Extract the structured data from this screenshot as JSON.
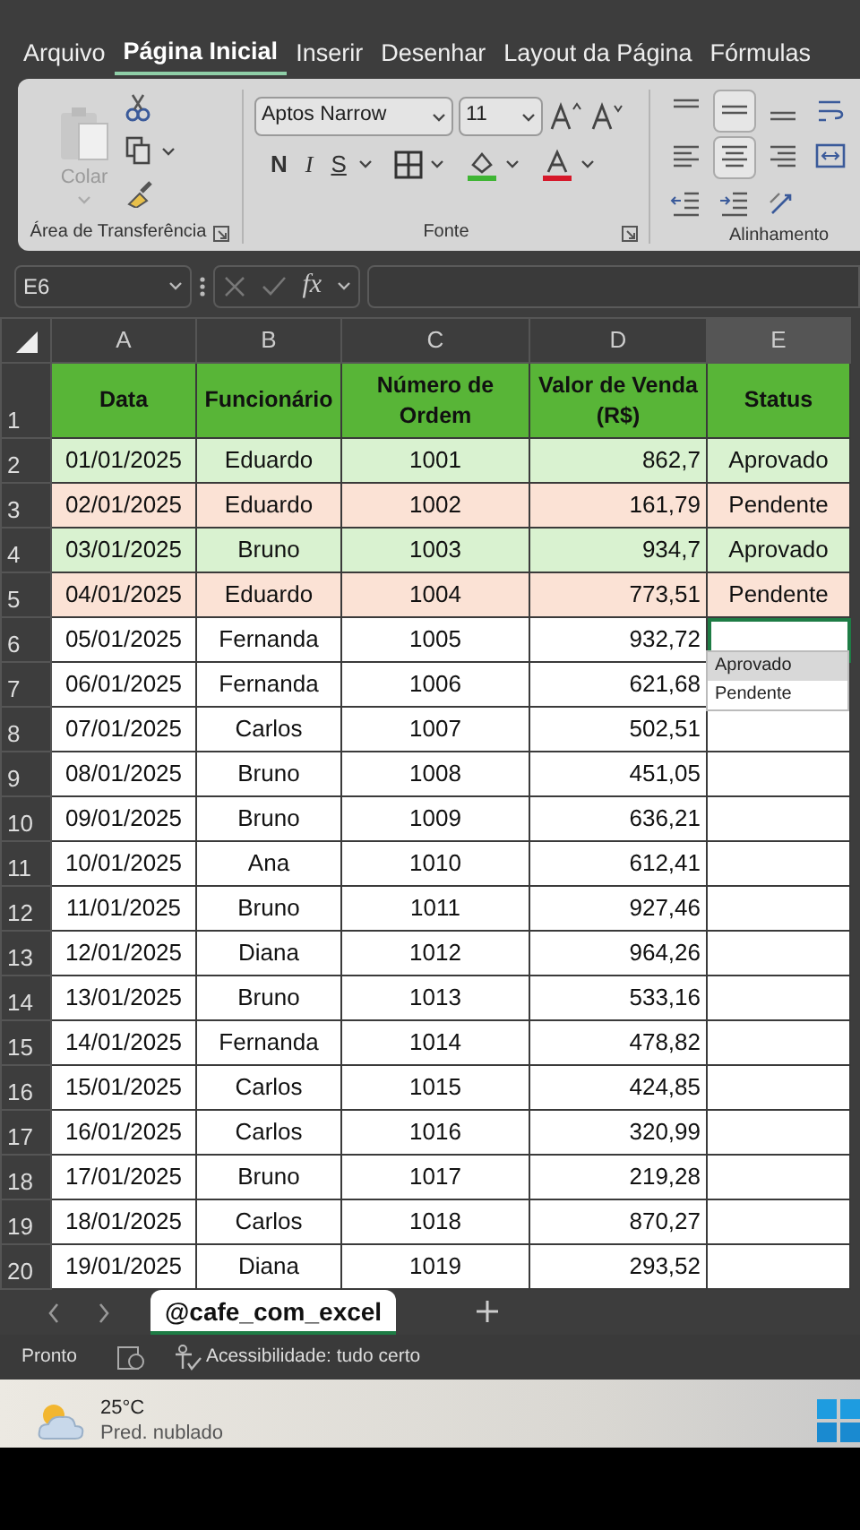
{
  "ribbon_tabs": [
    {
      "label": "Arquivo",
      "selected": false
    },
    {
      "label": "Página Inicial",
      "selected": true
    },
    {
      "label": "Inserir",
      "selected": false
    },
    {
      "label": "Desenhar",
      "selected": false
    },
    {
      "label": "Layout da Página",
      "selected": false
    },
    {
      "label": "Fórmulas",
      "selected": false
    }
  ],
  "clipboard": {
    "paste_label": "Colar",
    "paste_disabled": true,
    "group_label": "Área de Transferência"
  },
  "font": {
    "name": "Aptos Narrow",
    "size": "11",
    "bold_label": "N",
    "italic_label": "I",
    "underline_label": "S",
    "group_label": "Fonte"
  },
  "alignment": {
    "group_label": "Alinhamento"
  },
  "formula_bar": {
    "name_box": "E6",
    "function_label": "fx"
  },
  "columns": [
    {
      "label": "A",
      "selected": false
    },
    {
      "label": "B",
      "selected": false
    },
    {
      "label": "C",
      "selected": false
    },
    {
      "label": "D",
      "selected": false
    },
    {
      "label": "E",
      "selected": true
    }
  ],
  "header_row": {
    "number": "1",
    "color": "#58b537",
    "cells": [
      "Data",
      "Funcionário",
      "Número de Ordem",
      "Valor de Venda (R$)",
      "Status"
    ]
  },
  "rows": [
    {
      "number": "2",
      "cells": [
        "01/01/2025",
        "Eduardo",
        "1001",
        "862,7",
        "Aprovado"
      ],
      "color": "#d9f2d0",
      "selected": false
    },
    {
      "number": "3",
      "cells": [
        "02/01/2025",
        "Eduardo",
        "1002",
        "161,79",
        "Pendente"
      ],
      "color": "#fbe2d5",
      "selected": false
    },
    {
      "number": "4",
      "cells": [
        "03/01/2025",
        "Bruno",
        "1003",
        "934,7",
        "Aprovado"
      ],
      "color": "#d9f2d0",
      "selected": false
    },
    {
      "number": "5",
      "cells": [
        "04/01/2025",
        "Eduardo",
        "1004",
        "773,51",
        "Pendente"
      ],
      "color": "#fbe2d5",
      "selected": false
    },
    {
      "number": "6",
      "cells": [
        "05/01/2025",
        "Fernanda",
        "1005",
        "932,72",
        ""
      ],
      "selected": true
    },
    {
      "number": "7",
      "cells": [
        "06/01/2025",
        "Fernanda",
        "1006",
        "621,68",
        ""
      ],
      "selected": false
    },
    {
      "number": "8",
      "cells": [
        "07/01/2025",
        "Carlos",
        "1007",
        "502,51",
        ""
      ],
      "selected": false
    },
    {
      "number": "9",
      "cells": [
        "08/01/2025",
        "Bruno",
        "1008",
        "451,05",
        ""
      ],
      "selected": false
    },
    {
      "number": "10",
      "cells": [
        "09/01/2025",
        "Bruno",
        "1009",
        "636,21",
        ""
      ],
      "selected": false
    },
    {
      "number": "11",
      "cells": [
        "10/01/2025",
        "Ana",
        "1010",
        "612,41",
        ""
      ],
      "selected": false
    },
    {
      "number": "12",
      "cells": [
        "11/01/2025",
        "Bruno",
        "1011",
        "927,46",
        ""
      ],
      "selected": false
    },
    {
      "number": "13",
      "cells": [
        "12/01/2025",
        "Diana",
        "1012",
        "964,26",
        ""
      ],
      "selected": false
    },
    {
      "number": "14",
      "cells": [
        "13/01/2025",
        "Bruno",
        "1013",
        "533,16",
        ""
      ],
      "selected": false
    },
    {
      "number": "15",
      "cells": [
        "14/01/2025",
        "Fernanda",
        "1014",
        "478,82",
        ""
      ],
      "selected": false
    },
    {
      "number": "16",
      "cells": [
        "15/01/2025",
        "Carlos",
        "1015",
        "424,85",
        ""
      ],
      "selected": false
    },
    {
      "number": "17",
      "cells": [
        "16/01/2025",
        "Carlos",
        "1016",
        "320,99",
        ""
      ],
      "selected": false
    },
    {
      "number": "18",
      "cells": [
        "17/01/2025",
        "Bruno",
        "1017",
        "219,28",
        ""
      ],
      "selected": false
    },
    {
      "number": "19",
      "cells": [
        "18/01/2025",
        "Carlos",
        "1018",
        "870,27",
        ""
      ],
      "selected": false
    },
    {
      "number": "20",
      "cells": [
        "19/01/2025",
        "Diana",
        "1019",
        "293,52",
        ""
      ],
      "selected": false
    }
  ],
  "dropdown": {
    "items": [
      {
        "label": "Aprovado",
        "selected": true
      },
      {
        "label": "Pendente",
        "selected": false
      }
    ]
  },
  "sheet_tabs": [
    {
      "label": "@cafe_com_excel",
      "selected": true
    }
  ],
  "status_bar": {
    "mode": "Pronto",
    "accessibility": "Acessibilidade: tudo certo"
  },
  "taskbar": {
    "temperature": "25°C",
    "forecast": "Pred. nublado"
  }
}
